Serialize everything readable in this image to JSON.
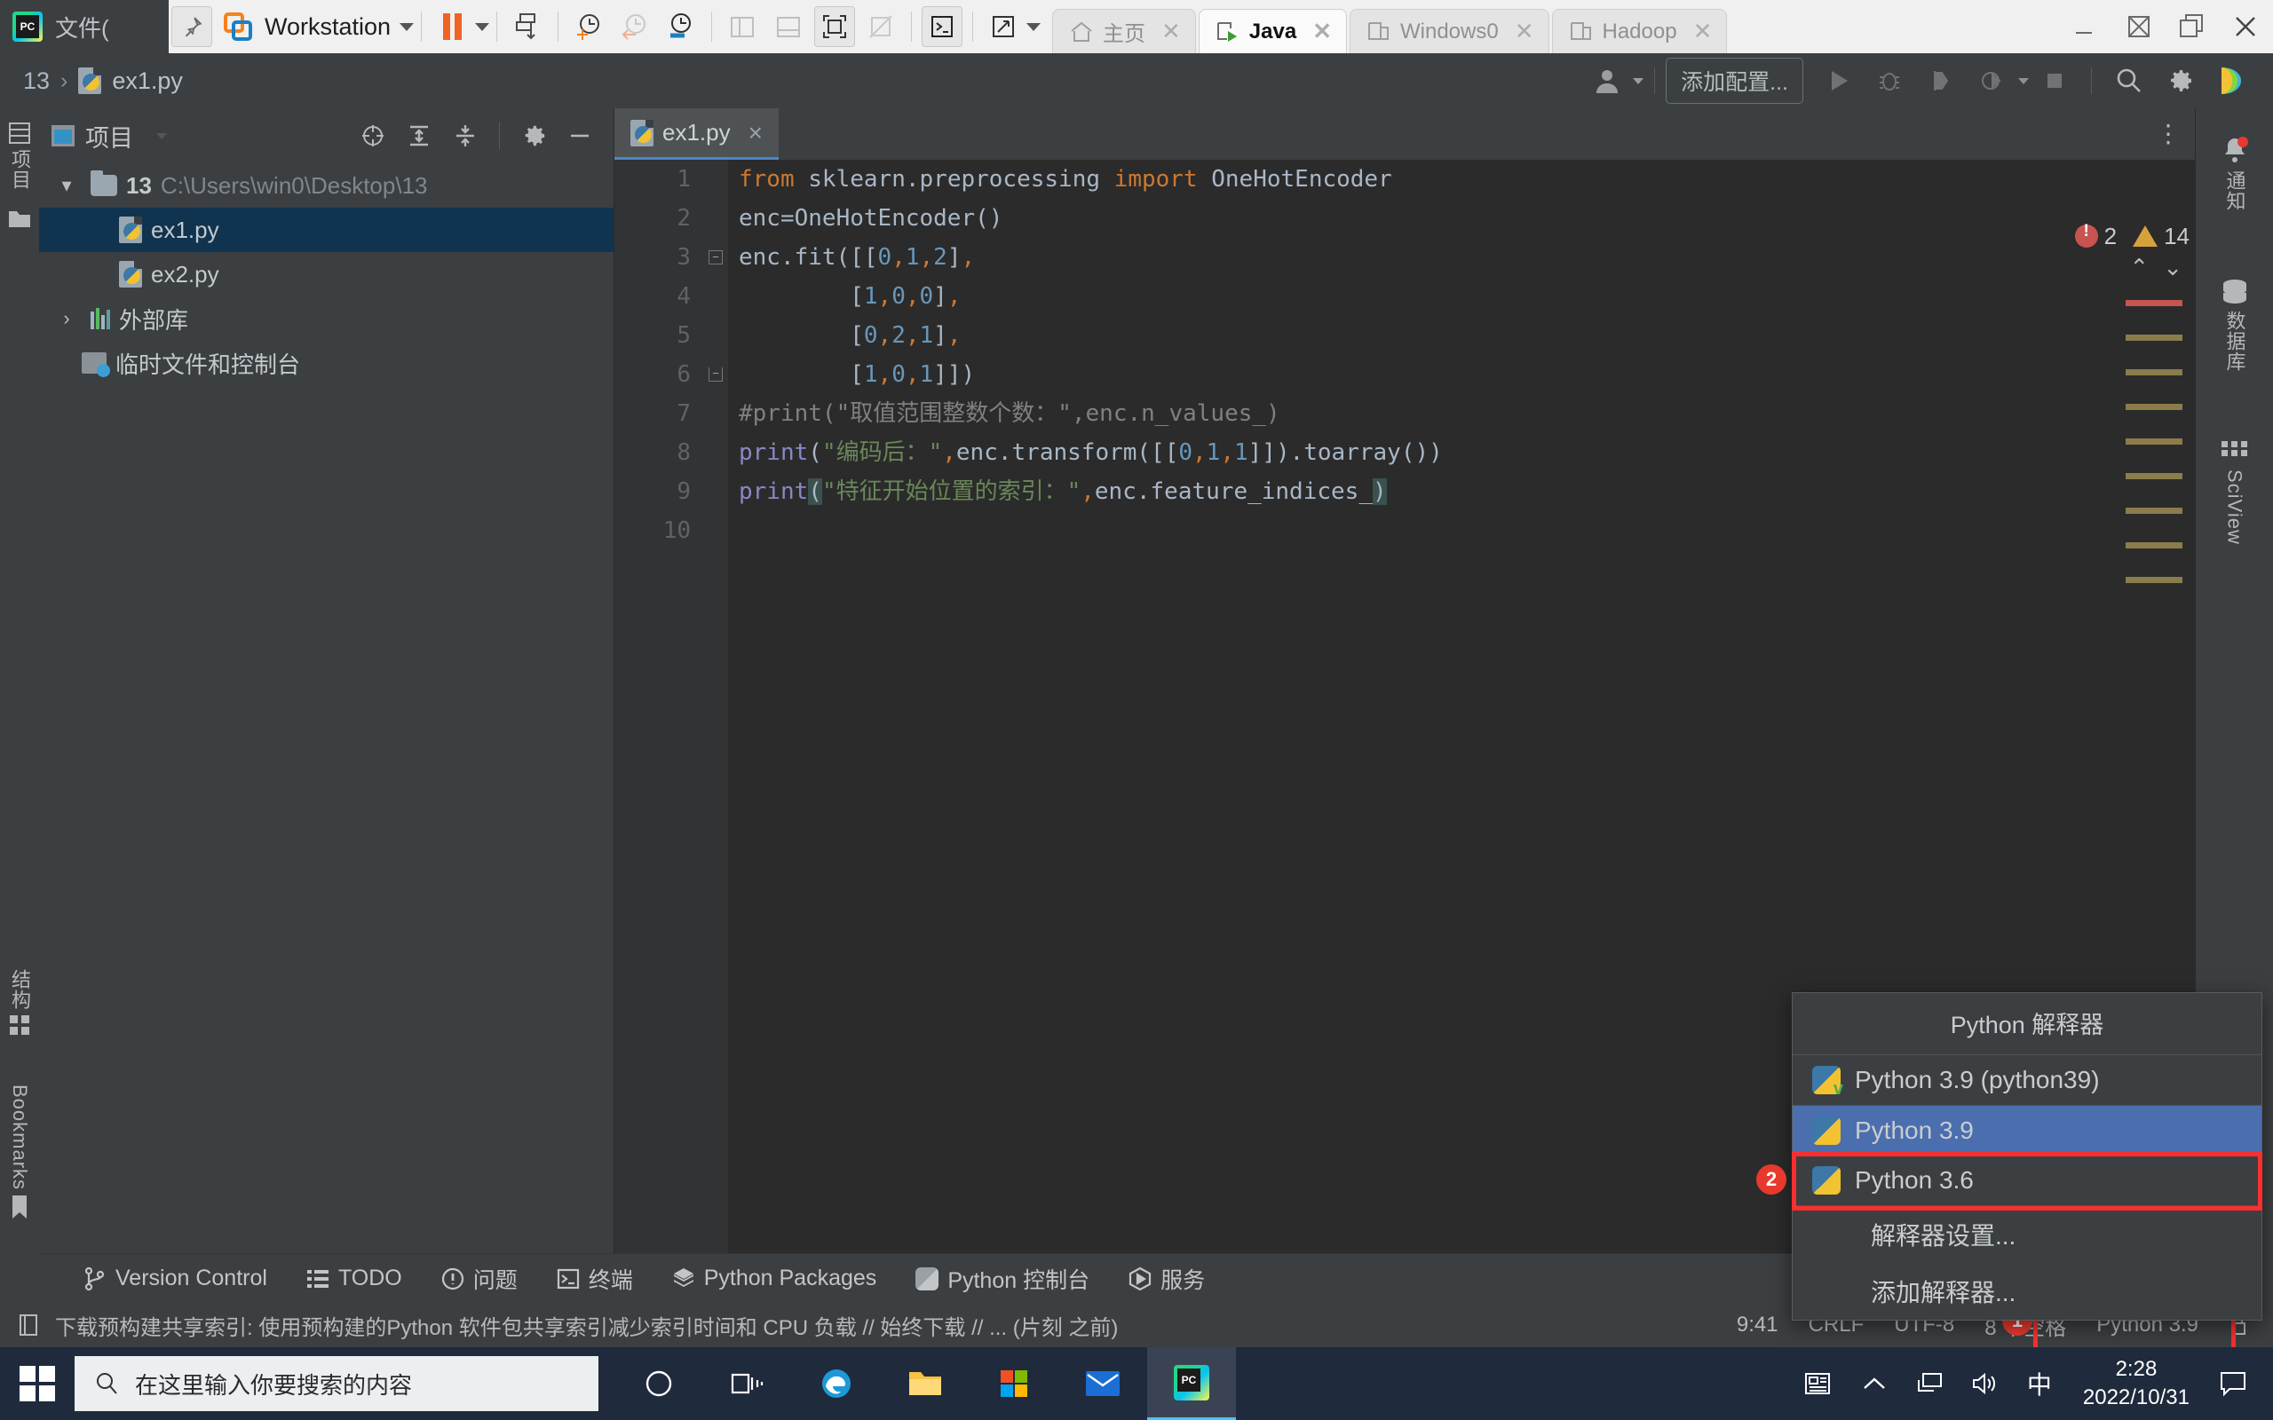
{
  "vmware": {
    "menu_label": "文件(",
    "window_title": "Workstation",
    "tabs": [
      {
        "label": "主页",
        "icon": "home-icon",
        "active": false,
        "closable": true
      },
      {
        "label": "Java",
        "icon": "vm-play-icon",
        "active": true,
        "closable": true
      },
      {
        "label": "Windows0",
        "icon": "vm-icon",
        "active": false,
        "closable": true
      },
      {
        "label": "Hadoop",
        "icon": "vm-icon",
        "active": false,
        "closable": true
      }
    ],
    "toolbar_icons": [
      "pin-icon",
      "vmware-logo-icon",
      "dropdown-caret-icon",
      "pause-icon",
      "snapshot-take-icon",
      "snapshot-add-icon",
      "snapshot-revert-icon",
      "snapshot-manager-icon",
      "view-console-icon",
      "view-library-icon",
      "view-fullscreen-icon",
      "view-unity-icon",
      "terminal-icon",
      "stretch-icon"
    ],
    "window_buttons": [
      "minimize-icon",
      "maximize-icon",
      "restore-icon",
      "close-icon"
    ]
  },
  "ide": {
    "breadcrumb": {
      "project": "13",
      "separator": "›",
      "file": "ex1.py"
    },
    "toolbar": {
      "account_icon": "user-account-icon",
      "add_config_label": "添加配置...",
      "run_icon": "run-icon",
      "debug_icon": "debug-icon",
      "coverage_icon": "run-coverage-icon",
      "profile_icon": "profile-icon",
      "stop_icon": "stop-icon",
      "search_icon": "search-everywhere-icon",
      "settings_icon": "gear-icon",
      "ai_icon": "ai-assistant-icon"
    },
    "left_strip": [
      {
        "label": "项目",
        "icon": "project-icon"
      },
      {
        "label": "",
        "icon": "folder-icon"
      },
      {
        "label": "结构",
        "icon": "structure-icon"
      },
      {
        "label": "Bookmarks",
        "icon": "bookmark-icon"
      }
    ],
    "right_strip": [
      {
        "label": "通知",
        "icon": "notifications-bell-icon"
      },
      {
        "label": "数据库",
        "icon": "database-icon"
      },
      {
        "label": "SciView",
        "icon": "sciview-grid-icon"
      }
    ],
    "project_panel": {
      "title": "项目",
      "header_icons": [
        "locate-icon",
        "expand-all-icon",
        "collapse-all-icon",
        "gear-icon",
        "hide-icon"
      ],
      "tree": [
        {
          "label": "13",
          "path": "C:\\Users\\win0\\Desktop\\13",
          "icon": "folder-icon",
          "arrow": "▾",
          "indent": 0,
          "selected": false
        },
        {
          "label": "ex1.py",
          "path": "",
          "icon": "python-file-icon",
          "arrow": "",
          "indent": 1,
          "selected": true
        },
        {
          "label": "ex2.py",
          "path": "",
          "icon": "python-file-icon",
          "arrow": "",
          "indent": 1,
          "selected": false
        },
        {
          "label": "外部库",
          "path": "",
          "icon": "library-icon",
          "arrow": "›",
          "indent": 0,
          "selected": false
        },
        {
          "label": "临时文件和控制台",
          "path": "",
          "icon": "scratches-icon",
          "arrow": "",
          "indent": 0,
          "selected": false
        }
      ]
    },
    "editor": {
      "tab_label": "ex1.py",
      "tab_close": "×",
      "more_icon": "more-vertical-icon",
      "inspection": {
        "error_count": "2",
        "warning_count": "14",
        "up_icon": "chevron-up-icon",
        "down_icon": "chevron-down-icon"
      },
      "line_numbers": [
        "1",
        "2",
        "3",
        "4",
        "5",
        "6",
        "7",
        "8",
        "9",
        "10"
      ],
      "lines": [
        "from sklearn.preprocessing import OneHotEncoder",
        "enc=OneHotEncoder()",
        "enc.fit([[0,1,2],",
        "        [1,0,0],",
        "        [0,2,1],",
        "        [1,0,1]])",
        "#print(\"取值范围整数个数：\",enc.n_values_)",
        "print(\"编码后：\",enc.transform([[0,1,1]]).toarray())",
        "print(\"特征开始位置的索引：\",enc.feature_indices_)",
        ""
      ]
    },
    "bottom_tools": [
      {
        "label": "Version Control",
        "icon": "branch-icon"
      },
      {
        "label": "TODO",
        "icon": "todo-list-icon"
      },
      {
        "label": "问题",
        "icon": "problems-icon"
      },
      {
        "label": "终端",
        "icon": "terminal-icon"
      },
      {
        "label": "Python Packages",
        "icon": "packages-icon"
      },
      {
        "label": "Python 控制台",
        "icon": "python-console-icon"
      },
      {
        "label": "服务",
        "icon": "services-icon"
      }
    ],
    "status_bar": {
      "icon": "indexing-icon",
      "message": "下载预构建共享索引: 使用预构建的Python 软件包共享索引减少索引时间和 CPU 负载 // 始终下载 // ... (片刻 之前)",
      "position": "9:41",
      "line_separator": "CRLF",
      "encoding": "UTF-8",
      "indent": "8 个空格",
      "interpreter": "Python 3.9",
      "lock_icon": "lock-icon",
      "annotation_1": "1"
    },
    "interpreter_popup": {
      "title": "Python 解释器",
      "items": [
        {
          "label": "Python 3.9 (python39)",
          "icon": "python-venv-icon",
          "highlighted": false,
          "boxed": false
        },
        {
          "label": "Python 3.9",
          "icon": "python-icon",
          "highlighted": true,
          "boxed": false
        },
        {
          "label": "Python 3.6",
          "icon": "python-icon",
          "highlighted": false,
          "boxed": true
        }
      ],
      "actions": [
        "解释器设置...",
        "添加解释器..."
      ],
      "annotation_2": "2"
    }
  },
  "taskbar": {
    "start_icon": "windows-start-icon",
    "search_placeholder": "在这里输入你要搜索的内容",
    "search_icon": "search-icon",
    "items": [
      {
        "icon": "cortana-circle-icon",
        "active": false
      },
      {
        "icon": "task-view-icon",
        "active": false
      },
      {
        "icon": "edge-browser-icon",
        "active": false
      },
      {
        "icon": "file-explorer-icon",
        "active": false
      },
      {
        "icon": "microsoft-store-icon",
        "active": false
      },
      {
        "icon": "mail-icon",
        "active": false
      },
      {
        "icon": "pycharm-icon",
        "active": true
      }
    ],
    "tray": {
      "news_icon": "news-weather-icon",
      "overflow_icon": "show-hidden-icons-icon",
      "network_icon": "network-icon",
      "volume_icon": "volume-icon",
      "ime_label": "中",
      "time": "2:28",
      "date": "2022/10/31",
      "notifications_icon": "action-center-icon"
    }
  },
  "colors": {
    "ide_bg": "#3c3f41",
    "editor_bg": "#2b2b2b",
    "accent_blue": "#4b6eaf",
    "selection_blue": "#10344f",
    "annotation_red": "#fb2f2f",
    "orange": "#f06423",
    "taskbar": "#1f2a3d"
  }
}
